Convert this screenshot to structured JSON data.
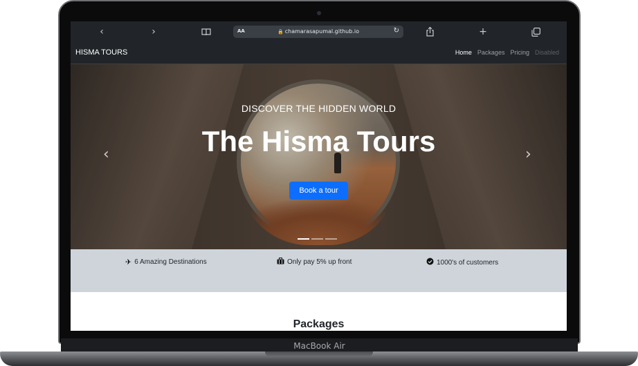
{
  "device": {
    "label": "MacBook Air"
  },
  "safari": {
    "aa": "AA",
    "url": "chamarasapumal.github.io"
  },
  "site": {
    "brand": "HISMA TOURS",
    "nav": [
      {
        "label": "Home",
        "state": "active"
      },
      {
        "label": "Packages",
        "state": "normal"
      },
      {
        "label": "Pricing",
        "state": "normal"
      },
      {
        "label": "Disabled",
        "state": "disabled"
      }
    ]
  },
  "hero": {
    "subtitle": "DISCOVER THE HIDDEN WORLD",
    "title": "The Hisma Tours",
    "button": "Book a tour",
    "slides": 3,
    "active_slide": 1
  },
  "features": [
    {
      "icon": "airplane-icon",
      "text": "6 Amazing Destinations"
    },
    {
      "icon": "suitcase-icon",
      "text": "Only pay 5% up front"
    },
    {
      "icon": "badge-check-icon",
      "text": "1000's of customers"
    }
  ],
  "packages": {
    "title": "Packages"
  },
  "colors": {
    "primary": "#0d6efd",
    "navbar": "#212529",
    "features_bg": "#ced4da"
  }
}
